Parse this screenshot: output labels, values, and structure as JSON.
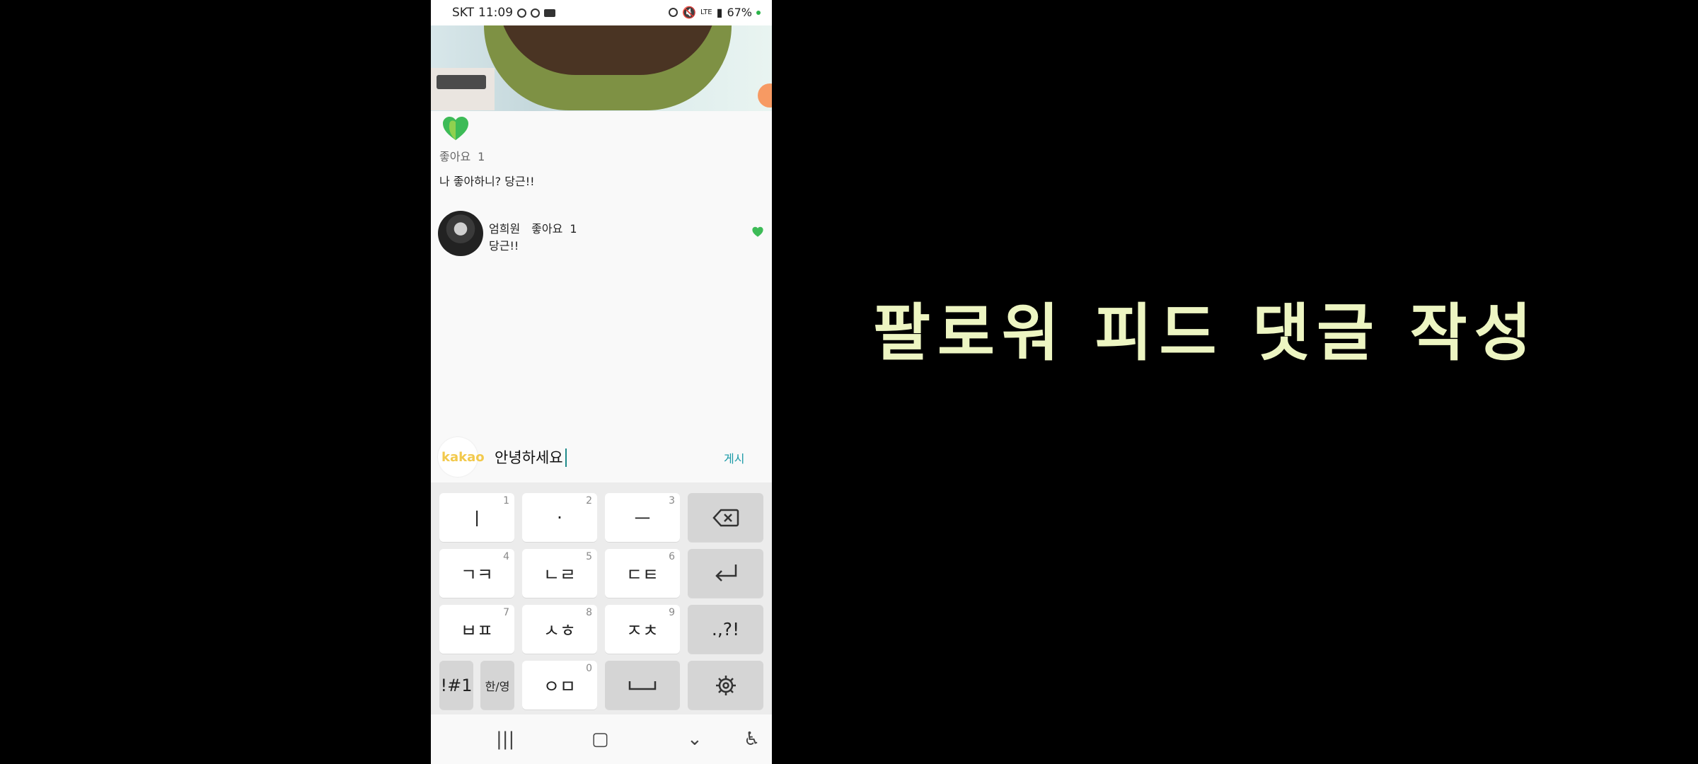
{
  "status_bar": {
    "carrier": "SKT",
    "time": "11:09",
    "battery": "67%",
    "network": "LTE"
  },
  "post": {
    "like_label": "좋아요",
    "like_count": "1",
    "caption": "나 좋아하니? 당근!!"
  },
  "comment": {
    "author": "엄희원",
    "like_label": "좋아요",
    "like_count": "1",
    "text": "당근!!"
  },
  "input": {
    "avatar_label": "kakao",
    "value": "안녕하세요",
    "post_label": "게시"
  },
  "keyboard": {
    "rows": [
      [
        {
          "label": "ㅣ",
          "num": "1"
        },
        {
          "label": "·",
          "num": "2"
        },
        {
          "label": "ㅡ",
          "num": "3"
        },
        {
          "label": "backspace",
          "num": ""
        }
      ],
      [
        {
          "label": "ㄱㅋ",
          "num": "4"
        },
        {
          "label": "ㄴㄹ",
          "num": "5"
        },
        {
          "label": "ㄷㅌ",
          "num": "6"
        },
        {
          "label": "enter",
          "num": ""
        }
      ],
      [
        {
          "label": "ㅂㅍ",
          "num": "7"
        },
        {
          "label": "ㅅㅎ",
          "num": "8"
        },
        {
          "label": "ㅈㅊ",
          "num": "9"
        },
        {
          "label": ".,?!",
          "num": ""
        }
      ],
      [
        {
          "label": "!#1",
          "num": ""
        },
        {
          "label": "한/영",
          "num": ""
        },
        {
          "label": "ㅇㅁ",
          "num": "0"
        },
        {
          "label": "space",
          "num": ""
        },
        {
          "label": "settings",
          "num": ""
        }
      ]
    ]
  },
  "headline": "팔로워 피드 댓글 작성",
  "colors": {
    "accent_teal": "#1a9aa7",
    "heart_green": "#3dbb57",
    "headline": "#edf5c2",
    "kakao_yellow": "#f2c94c"
  }
}
